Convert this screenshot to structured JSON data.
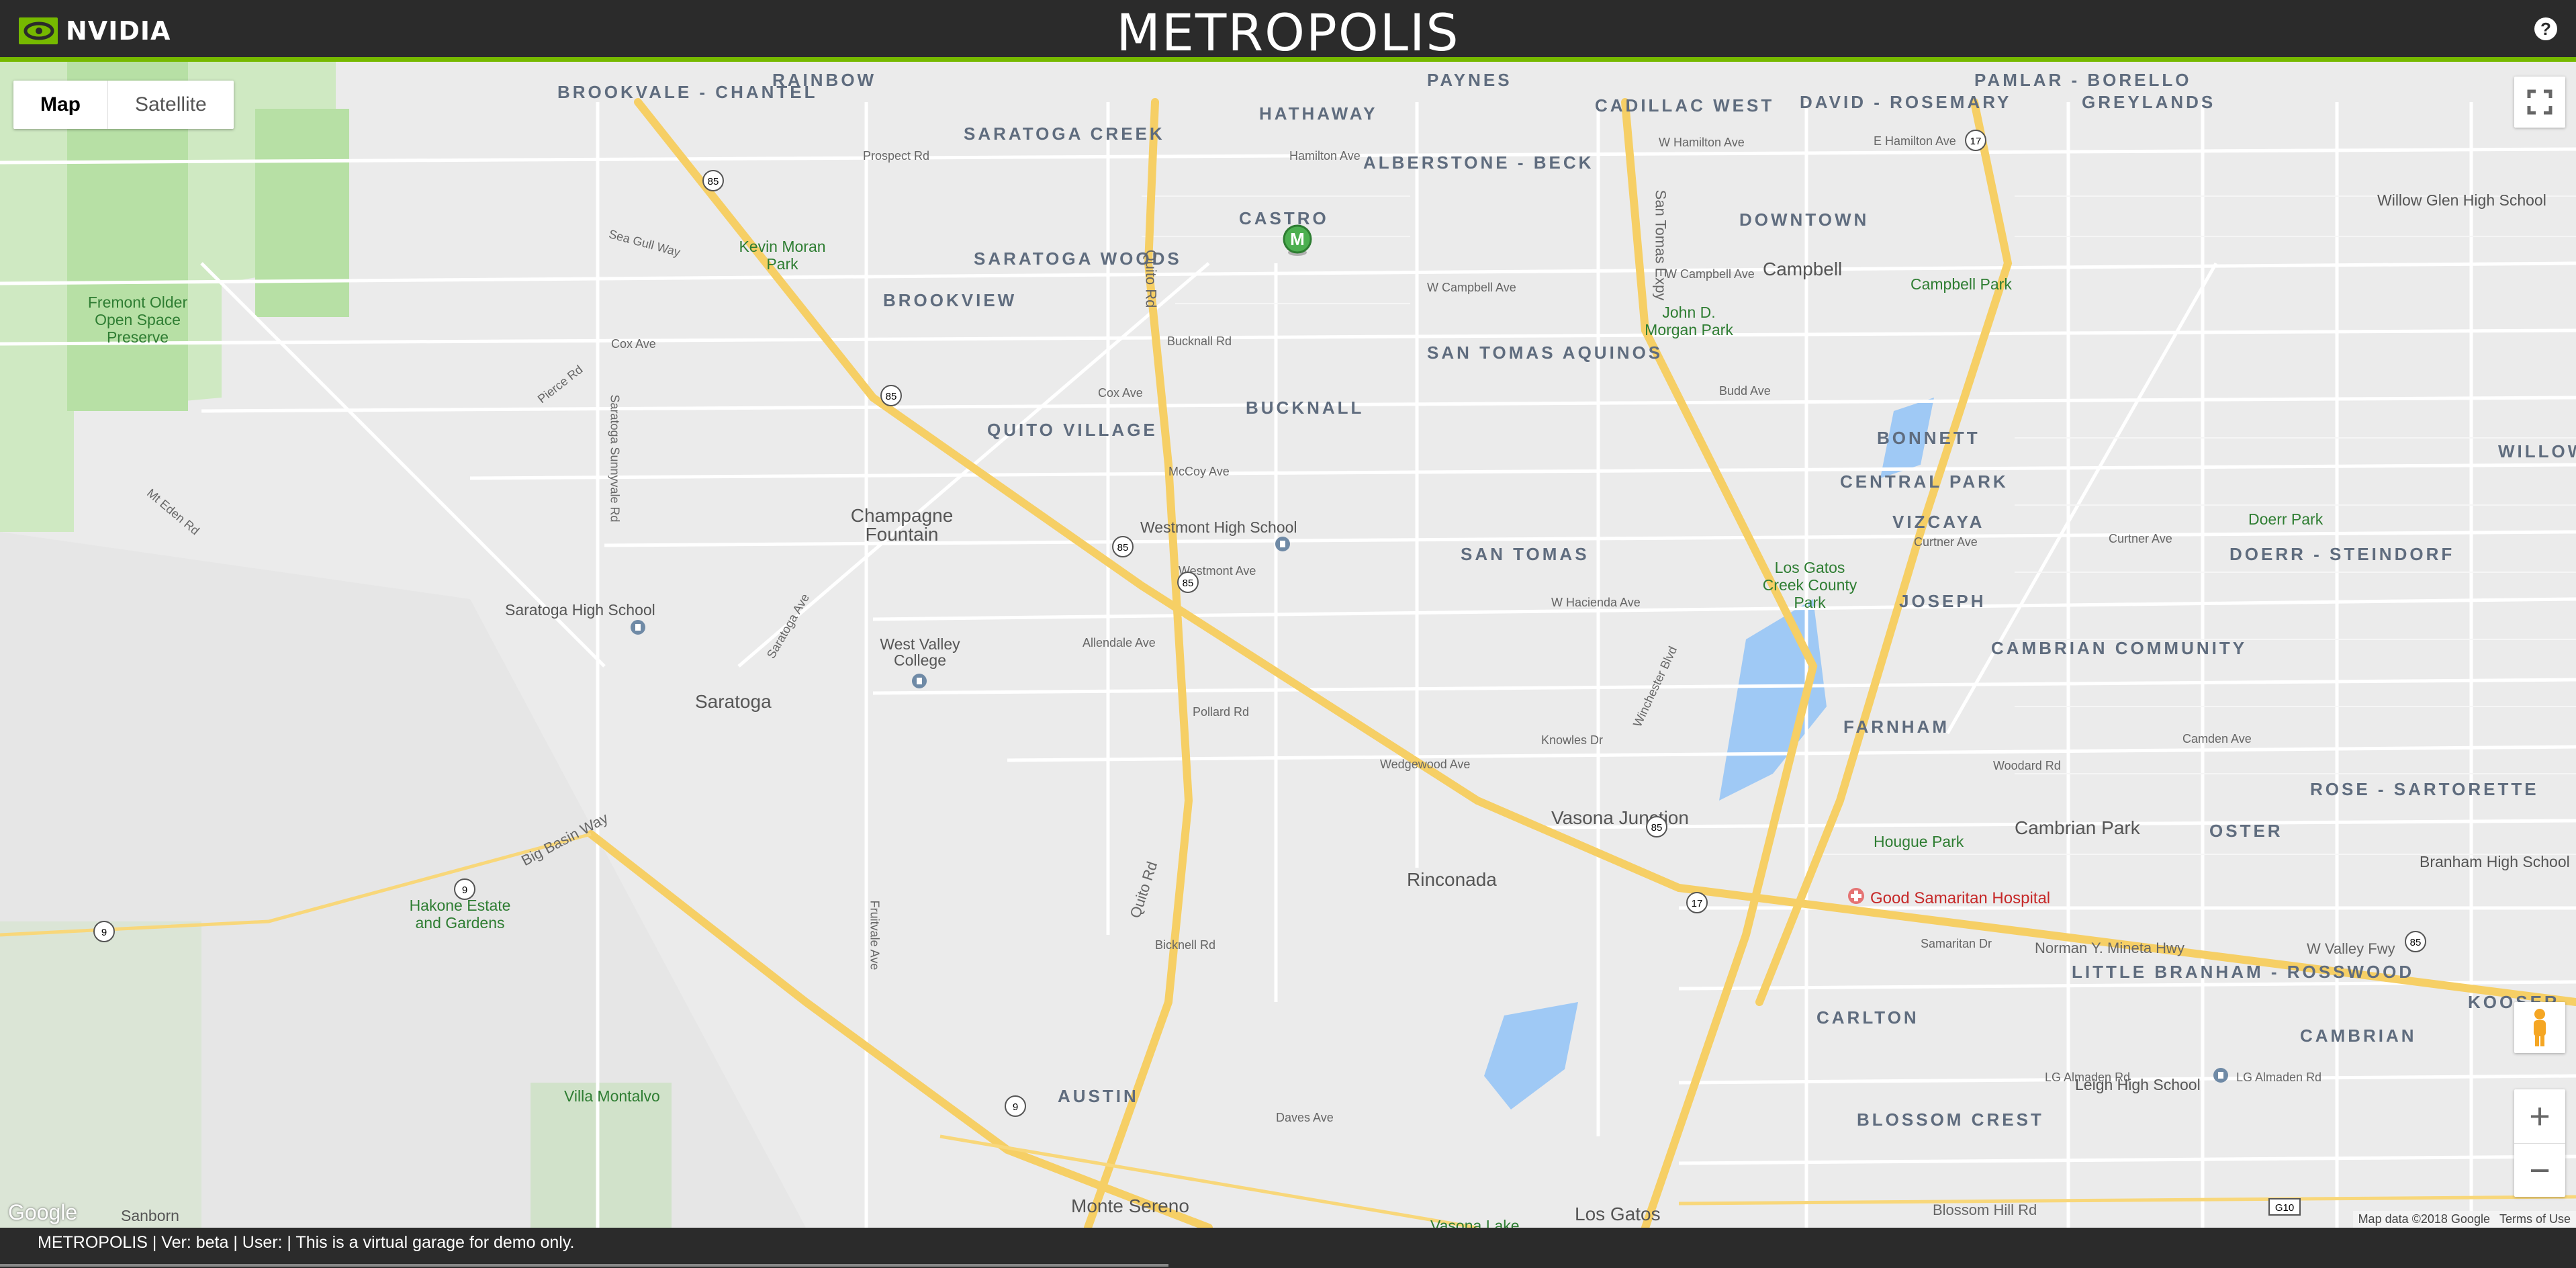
{
  "header": {
    "brand": "NVIDIA",
    "title": "METROPOLIS",
    "help_label": "?"
  },
  "map_controls": {
    "map_label": "Map",
    "satellite_label": "Satellite",
    "zoom_in": "+",
    "zoom_out": "−"
  },
  "marker": {
    "letter": "M"
  },
  "neighborhoods": {
    "brookvale_chantel": "BROOKVALE - CHANTEL",
    "rainbow": "RAINBOW",
    "saratoga_creek": "SARATOGA CREEK",
    "hathaway": "HATHAWAY",
    "paynes": "PAYNES",
    "cadillac_west": "CADILLAC WEST",
    "david_rosemary": "DAVID - ROSEMARY",
    "pamlar_borello": "PAMLAR - BORELLO",
    "greylands": "GREYLANDS",
    "alberstone_beck": "ALBERSTONE - BECK",
    "castro": "CASTRO",
    "downtown": "DOWNTOWN",
    "saratoga_woods": "SARATOGA WOODS",
    "brookview": "BROOKVIEW",
    "san_tomas_aquinos": "SAN TOMAS AQUINOS",
    "bucknall": "BUCKNALL",
    "quito_village": "QUITO VILLAGE",
    "bonnett": "BONNETT",
    "central_park": "CENTRAL PARK",
    "willow_south_lincoln": "WILLOW SOUTH LINCOLN",
    "vizcaya": "VIZCAYA",
    "doerr_steindorf": "DOERR - STEINDORF",
    "san_tomas": "SAN TOMAS",
    "joseph": "JOSEPH",
    "cambrian_community": "CAMBRIAN COMMUNITY",
    "farnham": "FARNHAM",
    "rose_sartorette": "ROSE - SARTORETTE",
    "oster": "OSTER",
    "little_branham_rosswood": "LITTLE BRANHAM - ROSSWOOD",
    "carlton": "CARLTON",
    "cambrian": "CAMBRIAN",
    "koosen": "KOOSER",
    "blossom_crest": "BLOSSOM CREST",
    "austin": "AUSTIN"
  },
  "places": {
    "campbell": "Campbell",
    "saratoga": "Saratoga",
    "champagne_fountain": "Champagne Fountain",
    "vasona_junction": "Vasona Junction",
    "rinconada": "Rinconada",
    "cambrian_park": "Cambrian Park",
    "monte_sereno": "Monte Sereno",
    "los_gatos": "Los Gatos",
    "sanborn": "Sanborn"
  },
  "parks": {
    "fremont_older": "Fremont Older Open Space Preserve",
    "kevin_moran": "Kevin Moran Park",
    "john_morgan": "John D. Morgan Park",
    "campbell_park": "Campbell Park",
    "doerr_park": "Doerr Park",
    "los_gatos_creek": "Los Gatos Creek County Park",
    "hakone": "Hakone Estate and Gardens",
    "villa_montalvo": "Villa Montalvo",
    "hougue_park": "Hougue Park",
    "vasona_lake": "Vasona Lake"
  },
  "pois": {
    "westmont_hs": "Westmont High School",
    "saratoga_hs": "Saratoga High School",
    "west_valley_college": "West Valley College",
    "willow_glen_hs": "Willow Glen High School",
    "branham_hs": "Branham High School",
    "leigh_hs": "Leigh High School",
    "good_samaritan": "Good Samaritan Hospital"
  },
  "roads": {
    "prospect": "Prospect Rd",
    "hamilton_ave": "Hamilton Ave",
    "w_hamilton": "W Hamilton Ave",
    "e_hamilton": "E Hamilton Ave",
    "w_campbell": "W Campbell Ave",
    "cox_ave": "Cox Ave",
    "bucknall_rd": "Bucknall Rd",
    "mccoy": "McCoy Ave",
    "westmont": "Westmont Ave",
    "allendale": "Allendale Ave",
    "pollard": "Pollard Rd",
    "knowles": "Knowles Dr",
    "wedgewood": "Wedgewood Ave",
    "w_hacienda": "W Hacienda Ave",
    "curtner": "Curtner Ave",
    "camden": "Camden Ave",
    "woodard": "Woodard Rd",
    "samaritan": "Samaritan Dr",
    "mineta": "Norman Y. Mineta Hwy",
    "w_valley_fwy": "W Valley Fwy",
    "lg_almaden": "LG Almaden Rd",
    "blossom_hill": "Blossom Hill Rd",
    "bicknell": "Bicknell Rd",
    "daves": "Daves Ave",
    "big_basin": "Big Basin Way",
    "quito_rd": "Quito Rd",
    "san_tomas_expy": "San Tomas Expy",
    "pierce_rd": "Pierce Rd",
    "mt_eden": "Mt Eden Rd",
    "saratoga_sunnyvale": "Saratoga Sunnyvale Rd",
    "saratoga_ave": "Saratoga Ave",
    "winchester": "Winchester Blvd",
    "budd": "Budd Ave",
    "sea_gull": "Sea Gull Way",
    "fruitvale": "Fruitvale Ave"
  },
  "shields": {
    "r85": "85",
    "r17": "17",
    "r9": "9",
    "g10": "G10"
  },
  "attribution": {
    "data": "Map data ©2018 Google",
    "terms": "Terms of Use",
    "google": "Google"
  },
  "footer": {
    "text": "METROPOLIS | Ver: beta | User: | This is a virtual garage for demo only."
  }
}
